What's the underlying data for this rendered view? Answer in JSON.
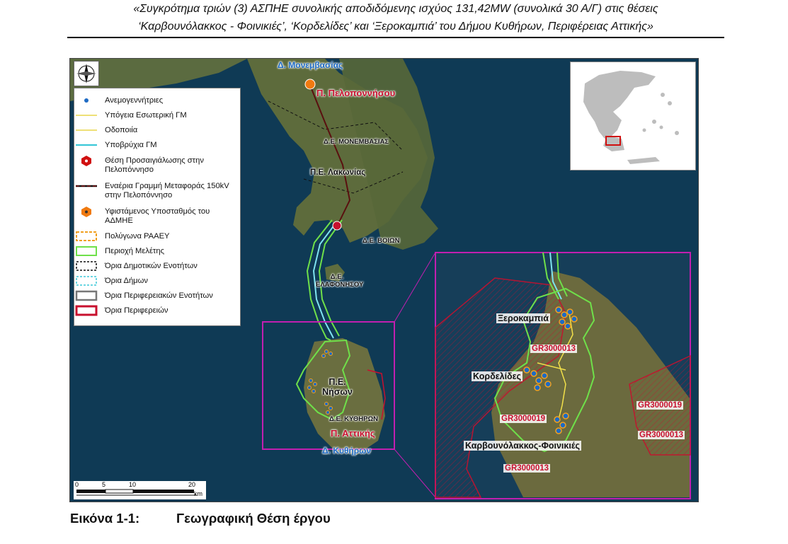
{
  "header": {
    "line1": "«Συγκρότημα τριών (3) ΑΣΠΗΕ συνολικής αποδιδόμενης ισχύος 131,42MW (συνολικά 30 Α/Γ) στις θέσεις",
    "line2": "‘Καρβουνόλακκος - Φοινικιές’, ‘Κορδελίδες’ και ‘Ξεροκαμπιά’ του Δήμου Κυθήρων, Περιφέρειας Αττικής»"
  },
  "legend": {
    "items": [
      {
        "label": "Ανεμογεννήτριες",
        "symbol": "blue-dot-icon"
      },
      {
        "label": "Υπόγεια Εσωτερική ΓΜ",
        "symbol": "yellow-line-icon"
      },
      {
        "label": "Οδοποιία",
        "symbol": "yellow-line-icon"
      },
      {
        "label": "Υποβρύχια ΓΜ",
        "symbol": "cyan-line-icon"
      },
      {
        "label": "Θέση Προσαιγιάλωσης στην Πελοπόννησο",
        "symbol": "red-hexagon-icon"
      },
      {
        "label": "Εναέρια Γραμμή Μεταφοράς 150kV στην Πελοπόννησο",
        "symbol": "dark-red-line-icon"
      },
      {
        "label": "Υφιστάμενος Υποσταθμός του ΑΔΜΗΕ",
        "symbol": "orange-hexagon-icon"
      },
      {
        "label": "Πολύγωνα ΡΑΑΕΥ",
        "symbol": "orange-dashed-box-icon"
      },
      {
        "label": "Περιοχή Μελέτης",
        "symbol": "green-box-icon"
      },
      {
        "label": "Όρια Δημοτικών Ενοτήτων",
        "symbol": "black-dashed-box-icon"
      },
      {
        "label": "Όρια Δήμων",
        "symbol": "cyan-dashed-box-icon"
      },
      {
        "label": "Όρια Περιφερειακών Ενοτήτων",
        "symbol": "grey-box-icon"
      },
      {
        "label": "Όρια Περιφερειών",
        "symbol": "red-box-icon"
      }
    ]
  },
  "map_labels": {
    "monemvasia_municipality": "Δ. Μονεμβασίας",
    "peloponnese_region": "Π. Πελοποννήσου",
    "monemvasia_unit": "Δ.Ε. ΜΟΝΕΜΒΑΣΙΑΣ",
    "lakonia": "Π.Ε. Λακωνίας",
    "voion": "Δ.Ε. ΒΟΙΩΝ",
    "elafonisos": "Δ.Ε. ΕΛΑΦΟΝΗΣΟΥ",
    "nison": "Π.Ε. Νήσων",
    "kythira_unit": "Δ.Ε. ΚΥΘΗΡΩΝ",
    "attica_region": "Π. Αττικής",
    "kythira_municipality": "Δ. Κυθήρων"
  },
  "inset_labels": {
    "xerokampia": "Ξεροκαμπιά",
    "kordelides": "Κορδελίδες",
    "karvounolakkos": "Καρβουνόλακκος-Φοινικιές",
    "gr1": "GR3000013",
    "gr2": "GR3000019",
    "gr3": "GR3000013",
    "gr4": "GR3000019",
    "gr5": "GR3000013"
  },
  "scale": {
    "t0": "0",
    "t5": "5",
    "t10": "10",
    "t20": "20",
    "unit": "km"
  },
  "caption": {
    "number": "Εικόνα 1-1:",
    "title": "Γεωγραφική Θέση έργου"
  },
  "colors": {
    "sea": "#0f3a55",
    "land": "#5a6a3e",
    "study_area": "#6fe04a",
    "raaey": "#f0a020",
    "region_border": "#c8102e",
    "frame": "#c21fb0",
    "cable": "#7fe3f0",
    "turbine": "#1e6bc4"
  }
}
